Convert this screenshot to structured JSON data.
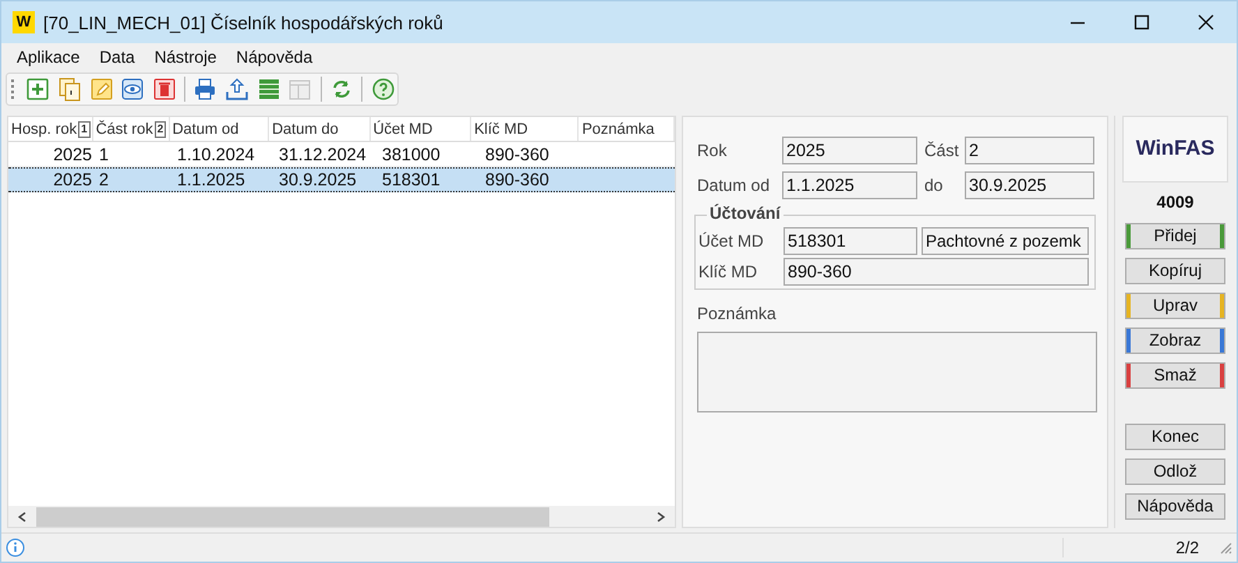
{
  "window": {
    "icon_text": "W",
    "title": "[70_LIN_MECH_01] Číselník hospodářských roků"
  },
  "menu": [
    "Aplikace",
    "Data",
    "Nástroje",
    "Nápověda"
  ],
  "toolbar": [
    {
      "kind": "add",
      "disabled": false
    },
    {
      "kind": "copy",
      "disabled": false
    },
    {
      "kind": "edit",
      "disabled": false
    },
    {
      "kind": "view",
      "disabled": false
    },
    {
      "kind": "delete",
      "disabled": false
    },
    {
      "kind": "separator"
    },
    {
      "kind": "print",
      "disabled": false
    },
    {
      "kind": "export",
      "disabled": false
    },
    {
      "kind": "table",
      "disabled": false
    },
    {
      "kind": "columns",
      "disabled": true
    },
    {
      "kind": "separator"
    },
    {
      "kind": "refresh",
      "disabled": false
    },
    {
      "kind": "separator"
    },
    {
      "kind": "help",
      "disabled": false
    }
  ],
  "table": {
    "columns": [
      {
        "label": "Hosp. rok",
        "sort": "1"
      },
      {
        "label": "Část rok",
        "sort": "2"
      },
      {
        "label": "Datum od"
      },
      {
        "label": "Datum do"
      },
      {
        "label": "Účet MD"
      },
      {
        "label": "Klíč MD"
      },
      {
        "label": "Poznámka"
      }
    ],
    "rows": [
      {
        "selected": false,
        "cells": [
          "2025",
          "1",
          "1.10.2024",
          "31.12.2024",
          "381000",
          "890-360"
        ]
      },
      {
        "selected": true,
        "cells": [
          "2025",
          "2",
          "1.1.2025",
          "30.9.2025",
          "518301",
          "890-360"
        ]
      }
    ]
  },
  "detail": {
    "rok": {
      "label": "Rok",
      "value": "2025"
    },
    "cast": {
      "label": "Část",
      "value": "2"
    },
    "datum_od": {
      "label": "Datum od",
      "value": "1.1.2025"
    },
    "datum_do": {
      "label": "do",
      "value": "30.9.2025"
    },
    "group": {
      "title": "Účtování",
      "ucet_md": {
        "label": "Účet MD",
        "value": "518301",
        "description": "Pachtovné z pozemk"
      },
      "klic_md": {
        "label": "Klíč MD",
        "value": "890-360"
      }
    },
    "poznamka": {
      "label": "Poznámka"
    }
  },
  "side": {
    "logo": "WinFAS",
    "number": "4009",
    "actions": [
      {
        "label": "Přidej",
        "color": "#4a9a3a"
      },
      {
        "label": "Kopíruj"
      },
      {
        "label": "Uprav",
        "color": "#e6b422"
      },
      {
        "label": "Zobraz",
        "color": "#3a78d6"
      },
      {
        "label": "Smaž",
        "color": "#d94040"
      }
    ],
    "footer_buttons": [
      "Konec",
      "Odlož",
      "Nápověda"
    ]
  },
  "status_bar": {
    "count": "2/2"
  }
}
